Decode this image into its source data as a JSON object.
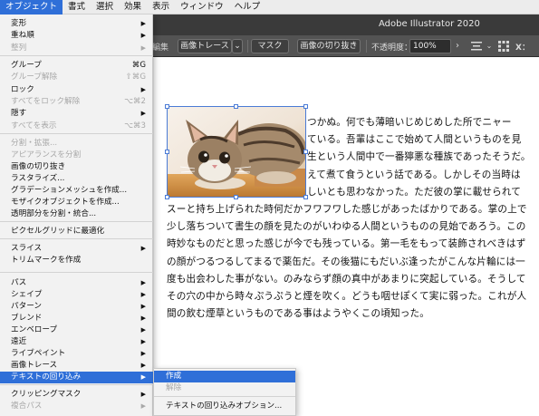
{
  "menubar": {
    "items": [
      "オブジェクト",
      "書式",
      "選択",
      "効果",
      "表示",
      "ウィンドウ",
      "ヘルプ"
    ]
  },
  "titlebar": {
    "title": "Adobe Illustrator 2020"
  },
  "controlbar": {
    "edit_label": "編集",
    "image_trace": "画像トレース",
    "mask": "マスク",
    "crop_image": "画像の切り抜き",
    "opacity_label": "不透明度：",
    "opacity_value": "100%",
    "x_label": "X："
  },
  "menu": {
    "items": [
      {
        "label": "変形",
        "submenu": true,
        "enabled": true
      },
      {
        "label": "重ね順",
        "submenu": true,
        "enabled": true
      },
      {
        "label": "整列",
        "submenu": true,
        "enabled": false
      },
      {
        "label": "グループ",
        "shortcut": "⌘G",
        "enabled": true
      },
      {
        "label": "グループ解除",
        "shortcut": "⇧⌘G",
        "enabled": false
      },
      {
        "label": "ロック",
        "submenu": true,
        "enabled": true
      },
      {
        "label": "すべてをロック解除",
        "shortcut": "⌥⌘2",
        "enabled": false
      },
      {
        "label": "隠す",
        "submenu": true,
        "enabled": true
      },
      {
        "label": "すべてを表示",
        "shortcut": "⌥⌘3",
        "enabled": false
      },
      {
        "label": "分割・拡張...",
        "enabled": false
      },
      {
        "label": "アピアランスを分割",
        "enabled": false
      },
      {
        "label": "画像の切り抜き",
        "enabled": true
      },
      {
        "label": "ラスタライズ...",
        "enabled": true
      },
      {
        "label": "グラデーションメッシュを作成...",
        "enabled": true
      },
      {
        "label": "モザイクオブジェクトを作成...",
        "enabled": true
      },
      {
        "label": "透明部分を分割・統合...",
        "enabled": true
      },
      {
        "label": "ピクセルグリッドに最適化",
        "enabled": true
      },
      {
        "label": "スライス",
        "submenu": true,
        "enabled": true
      },
      {
        "label": "トリムマークを作成",
        "enabled": true
      },
      {
        "label": "パス",
        "submenu": true,
        "enabled": true
      },
      {
        "label": "シェイプ",
        "submenu": true,
        "enabled": true
      },
      {
        "label": "パターン",
        "submenu": true,
        "enabled": true
      },
      {
        "label": "ブレンド",
        "submenu": true,
        "enabled": true
      },
      {
        "label": "エンベロープ",
        "submenu": true,
        "enabled": true
      },
      {
        "label": "遠近",
        "submenu": true,
        "enabled": true
      },
      {
        "label": "ライブペイント",
        "submenu": true,
        "enabled": true
      },
      {
        "label": "画像トレース",
        "submenu": true,
        "enabled": true
      },
      {
        "label": "テキストの回り込み",
        "submenu": true,
        "enabled": true,
        "highlighted": true
      },
      {
        "label": "クリッピングマスク",
        "submenu": true,
        "enabled": true
      },
      {
        "label": "複合パス",
        "submenu": true,
        "enabled": false
      }
    ]
  },
  "submenu": {
    "items": [
      {
        "label": "作成",
        "enabled": true,
        "highlighted": true
      },
      {
        "label": "解除",
        "enabled": false
      },
      {
        "label": "テキストの回り込みオプション...",
        "enabled": true
      }
    ]
  },
  "document": {
    "lines": [
      "つかぬ。何でも薄暗いじめじめした所でニャー",
      "ている。吾輩はここで始めて人間というものを見",
      "生という人間中で一番獰悪な種族であったそうだ。",
      "えて煮て食うという話である。しかしその当時は",
      "しいとも思わなかった。ただ彼の掌に載せられて",
      "スーと持ち上げられた時何だかフワフワした感じがあったばかりである。掌の上で",
      "少し落ちついて書生の顔を見たのがいわゆる人間というものの見始であろう。この",
      "時妙なものだと思った感じが今でも残っている。第一毛をもって装飾されべきはず",
      "の顔がつるつるしてまるで薬缶だ。その後猫にもだいぶ逢ったがこんな片輪には一",
      "度も出会わした事がない。のみならず顔の真中があまりに突起している。そうして",
      "その穴の中から時々ぷうぷうと煙を吹く。どうも咽せぽくて実に弱った。これが人",
      "間の飲む煙草というものである事はようやくこの頃知った。"
    ]
  },
  "colors": {
    "menu_highlight": "#2f6fd8",
    "title_bar": "#3a3a3a",
    "control_bar": "#535353"
  }
}
